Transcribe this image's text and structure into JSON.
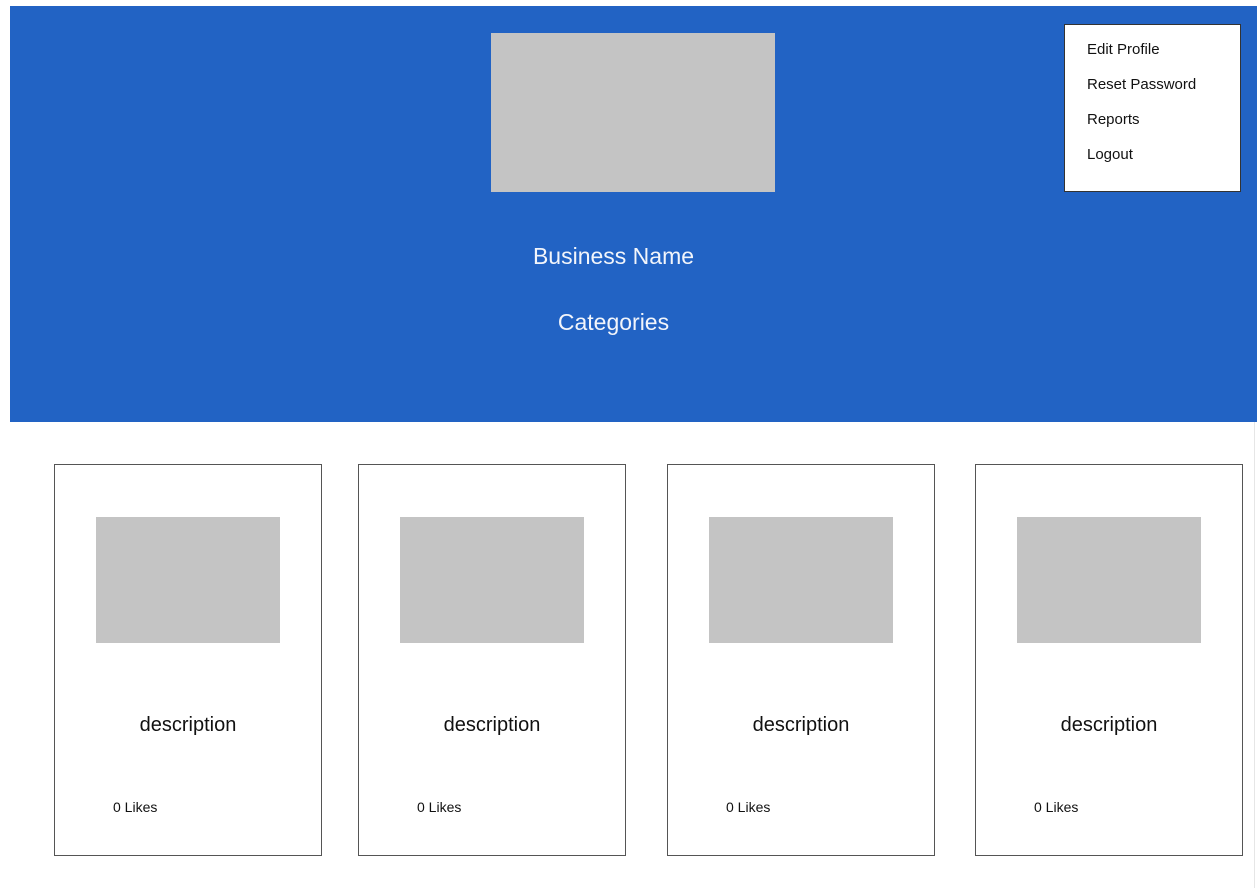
{
  "header": {
    "business_name": "Business Name",
    "categories": "Categories",
    "background_color": "#2263c4"
  },
  "menu": {
    "items": [
      {
        "label": "Edit Profile"
      },
      {
        "label": "Reset Password"
      },
      {
        "label": "Reports"
      },
      {
        "label": "Logout"
      }
    ]
  },
  "cards": [
    {
      "description": "description",
      "likes": "0 Likes"
    },
    {
      "description": "description",
      "likes": "0 Likes"
    },
    {
      "description": "description",
      "likes": "0 Likes"
    },
    {
      "description": "description",
      "likes": "0 Likes"
    }
  ],
  "placeholder_color": "#c4c4c4"
}
